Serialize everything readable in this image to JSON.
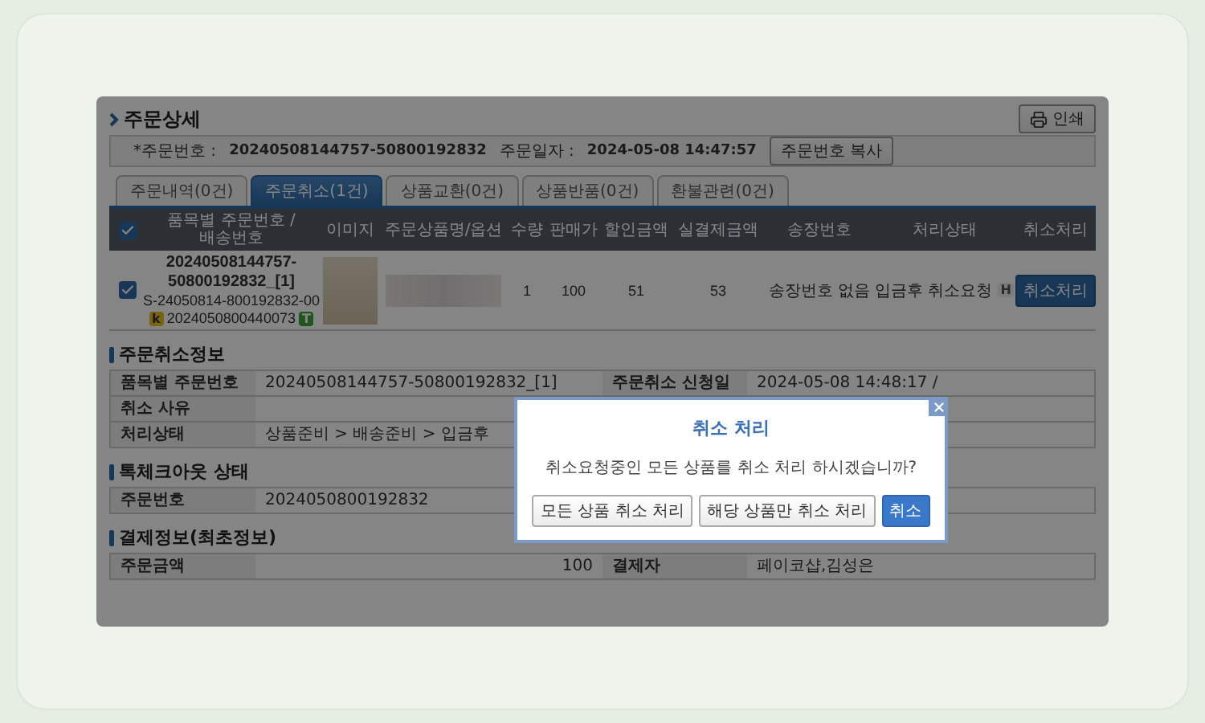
{
  "page": {
    "title": "주문상세",
    "print_button": "인쇄"
  },
  "order_info": {
    "order_no_label": "*주문번호 :",
    "order_no": "20240508144757-50800192832",
    "order_date_label": "주문일자 :",
    "order_date": "2024-05-08 14:47:57",
    "copy_button": "주문번호 복사"
  },
  "tabs": [
    {
      "label": "주문내역(0건)",
      "selected": false
    },
    {
      "label": "주문취소(1건)",
      "selected": true
    },
    {
      "label": "상품교환(0건)",
      "selected": false
    },
    {
      "label": "상품반품(0건)",
      "selected": false
    },
    {
      "label": "환불관련(0건)",
      "selected": false
    }
  ],
  "items_table": {
    "select_all_checked": true,
    "columns": [
      "품목별 주문번호 /배송번호",
      "이미지",
      "주문상품명/옵션",
      "수량",
      "판매가",
      "할인금액",
      "실결제금액",
      "송장번호",
      "처리상태",
      "취소처리"
    ],
    "rows": [
      {
        "checked": true,
        "item_order_no": "20240508144757-50800192832_[1]",
        "shipping_no": "S-24050814-800192832-00",
        "badge": "k",
        "sub_no": "2024050800440073",
        "badge_2": "T",
        "qty": "1",
        "price": "100",
        "discount": "51",
        "paid": "53",
        "invoice": "송장번호 없음",
        "status": "입금후 취소요청",
        "status_badge": "H",
        "action": "취소처리"
      }
    ]
  },
  "cancel_info": {
    "title": "주문취소정보",
    "rows": [
      [
        {
          "label": "품목별 주문번호",
          "value": "20240508144757-50800192832_[1]"
        },
        {
          "label": "주문취소 신청일",
          "value": "2024-05-08 14:48:17 /"
        }
      ],
      [
        {
          "label": "취소 사유"
        }
      ],
      [
        {
          "label": "처리상태",
          "value": "상품준비 > 배송준비 > 입금후"
        }
      ]
    ]
  },
  "checkout_status": {
    "title": "톡체크아웃 상태",
    "rows": [
      [
        {
          "label": "주문번호",
          "value": "2024050800192832"
        }
      ]
    ]
  },
  "payment_info": {
    "title": "결제정보(최초정보)",
    "rows": [
      [
        {
          "label": "주문금액",
          "value": "100",
          "kind": "amount"
        },
        {
          "label": "결제자",
          "value": "페이코샵,김성은"
        }
      ]
    ]
  },
  "dialog": {
    "title": "취소 처리",
    "message": "취소요청중인 모든 상품를 취소 처리 하시겠습니까?",
    "buttons": [
      {
        "label": "모든 상품 취소 처리",
        "kind": "secondary"
      },
      {
        "label": "해당 상품만 취소 처리",
        "kind": "secondary"
      },
      {
        "label": "취소",
        "kind": "primary"
      }
    ]
  }
}
